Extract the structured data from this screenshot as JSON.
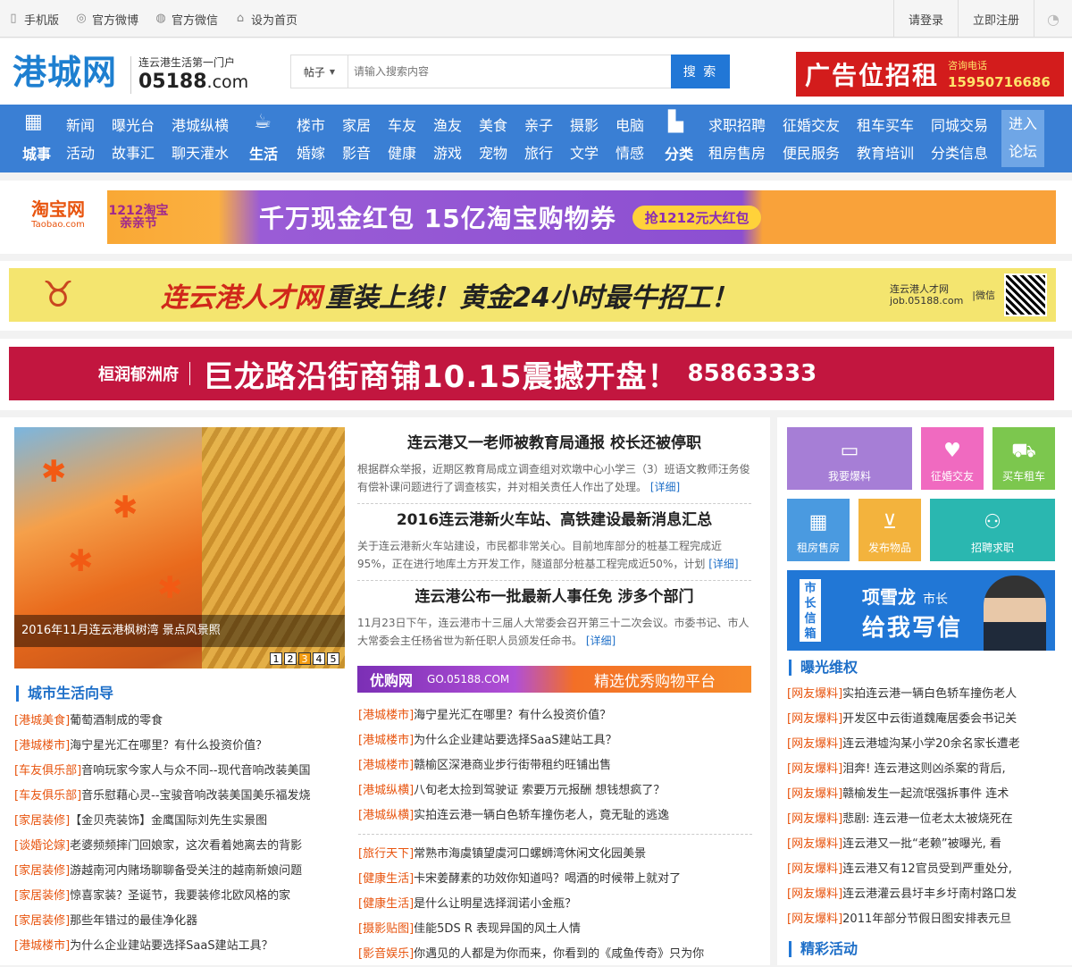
{
  "topbar": {
    "left": [
      {
        "icon": "mobile-icon",
        "label": "手机版"
      },
      {
        "icon": "weibo-icon",
        "label": "官方微博"
      },
      {
        "icon": "wechat-icon",
        "label": "官方微信"
      },
      {
        "icon": "home-icon",
        "label": "设为首页"
      }
    ],
    "login": "请登录",
    "register": "立即注册"
  },
  "header": {
    "logo": "港城网",
    "slogan": "连云港生活第一门户",
    "domain_num": "05188",
    "domain_tld": ".com",
    "search": {
      "type": "帖子",
      "placeholder": "请输入搜索内容",
      "button": "搜 索"
    },
    "ad": {
      "title": "广告位招租",
      "phone_label": "咨询电话",
      "phone": "15950716686"
    }
  },
  "nav": {
    "groups": [
      {
        "icon": "building-icon",
        "category": "城事",
        "row1": [
          "新闻",
          "曝光台",
          "港城纵横"
        ],
        "row2": [
          "活动",
          "故事汇",
          "聊天灌水"
        ]
      },
      {
        "icon": "cup-icon",
        "category": "生活",
        "row1": [
          "楼市",
          "家居",
          "车友",
          "渔友",
          "美食",
          "亲子",
          "摄影",
          "电脑"
        ],
        "row2": [
          "婚嫁",
          "影音",
          "健康",
          "游戏",
          "宠物",
          "旅行",
          "文学",
          "情感"
        ]
      },
      {
        "icon": "factory-icon",
        "category": "分类",
        "row1": [
          "求职招聘",
          "征婚交友",
          "租车买车",
          "同城交易"
        ],
        "row2": [
          "租房售房",
          "便民服务",
          "教育培训",
          "分类信息"
        ]
      }
    ],
    "enter": [
      "进入",
      "论坛"
    ]
  },
  "banners": {
    "taobao": {
      "brand": "淘宝网",
      "brand_sub": "Taobao.com",
      "event": "1212淘宝亲亲节",
      "main": "千万现金红包 15亿淘宝购物券",
      "pill": "抢1212元大红包"
    },
    "talent": {
      "t1": "连云港人才网",
      "t2": "重装上线！黄金24小时最牛招工！",
      "site": "连云港人才网",
      "url": "job.05188.com",
      "wx": "|微信"
    },
    "shop": {
      "logo": "桓润郁洲府",
      "main": "巨龙路沿街商铺10.15震撼开盘！",
      "phone": "85863333"
    }
  },
  "slider": {
    "caption": "2016年11月连云港枫树湾 景点风景照",
    "pages": [
      "1",
      "2",
      "3",
      "4",
      "5"
    ],
    "active": 3
  },
  "headlines": [
    {
      "title": "连云港又一老师被教育局通报 校长还被停职",
      "summary": "根据群众举报，近期区教育局成立调查组对欢墩中心小学三（3）班语文教师汪务俊有偿补课问题进行了调查核实，并对相关责任人作出了处理。",
      "more": "[详细]"
    },
    {
      "title": "2016连云港新火车站、高铁建设最新消息汇总",
      "summary": "关于连云港新火车站建设，市民都非常关心。目前地库部分的桩基工程完成近95%，正在进行地库土方开发工作，隧道部分桩基工程完成近50%，计划",
      "more": "[详细]"
    },
    {
      "title": "连云港公布一批最新人事任免 涉多个部门",
      "summary": "11月23日下午，连云港市十三届人大常委会召开第三十二次会议。市委书记、市人大常委会主任杨省世为新任职人员颁发任命书。",
      "more": "[详细]"
    }
  ],
  "shopbar": {
    "name": "优购网",
    "url": "GO.05188.COM",
    "slogan": "精选优秀购物平台"
  },
  "mid_list_a": [
    {
      "tag": "[港城楼市]",
      "text": "海宁星光汇在哪里？有什么投资价值？"
    },
    {
      "tag": "[港城楼市]",
      "text": "为什么企业建站要选择SaaS建站工具？"
    },
    {
      "tag": "[港城楼市]",
      "text": "赣榆区深港商业步行街带租约旺铺出售"
    },
    {
      "tag": "[港城纵横]",
      "text": "八旬老太捡到驾驶证 索要万元报酬 想钱想疯了？"
    },
    {
      "tag": "[港城纵横]",
      "text": "实拍连云港一辆白色轿车撞伤老人，竟无耻的逃逸"
    }
  ],
  "mid_list_b": [
    {
      "tag": "[旅行天下]",
      "text": "常熟市海虞镇望虞河口螺蛳湾休闲文化园美景"
    },
    {
      "tag": "[健康生活]",
      "text": "卡宋姜酵素的功效你知道吗？喝酒的时候带上就对了"
    },
    {
      "tag": "[健康生活]",
      "text": "是什么让明星选择润诺小金瓶？"
    },
    {
      "tag": "[摄影贴图]",
      "text": "佳能5DS R 表现异国的风土人情"
    },
    {
      "tag": "[影音娱乐]",
      "text": "你遇见的人都是为你而来，你看到的《咸鱼传奇》只为你"
    }
  ],
  "city_guide": {
    "title": "城市生活向导",
    "items": [
      {
        "tag": "[港城美食]",
        "text": "葡萄酒制成的零食"
      },
      {
        "tag": "[港城楼市]",
        "text": "海宁星光汇在哪里？有什么投资价值？"
      },
      {
        "tag": "[车友俱乐部]",
        "text": "音响玩家今家人与众不同--现代音响改装美国"
      },
      {
        "tag": "[车友俱乐部]",
        "text": "音乐慰藉心灵--宝骏音响改装美国美乐福发烧"
      },
      {
        "tag": "[家居装修]",
        "text": "【金贝壳装饰】金鹰国际刘先生实景图"
      },
      {
        "tag": "[谈婚论嫁]",
        "text": "老婆频频摔门回娘家，这次看着她离去的背影"
      },
      {
        "tag": "[家居装修]",
        "text": "游越南河内赌场聊聊备受关注的越南新娘问题"
      },
      {
        "tag": "[家居装修]",
        "text": "惊喜家装？圣诞节，我要装修北欧风格的家"
      },
      {
        "tag": "[家居装修]",
        "text": "那些年错过的最佳净化器"
      },
      {
        "tag": "[港城楼市]",
        "text": "为什么企业建站要选择SaaS建站工具？"
      }
    ]
  },
  "tiles": [
    {
      "icon": "chat-icon",
      "label": "我要爆料",
      "color": "#a67ed6"
    },
    {
      "icon": "heart-icon",
      "label": "征婚交友",
      "color": "#f06ac0"
    },
    {
      "icon": "car-icon",
      "label": "买车租车",
      "color": "#7cc74e"
    },
    {
      "icon": "grid-building-icon",
      "label": "租房售房",
      "color": "#4a9ae0"
    },
    {
      "icon": "basket-icon",
      "label": "发布物品",
      "color": "#f3b33d"
    },
    {
      "icon": "people-icon",
      "label": "招聘求职",
      "color": "#2ab7b0"
    }
  ],
  "mayor": {
    "vertical": "市长信箱",
    "name": "项雪龙",
    "title": "市长",
    "write": "给我写信"
  },
  "exposure": {
    "title": "曝光维权",
    "items": [
      {
        "tag": "[网友爆料]",
        "text": "实拍连云港一辆白色轿车撞伤老人"
      },
      {
        "tag": "[网友爆料]",
        "text": "开发区中云街道魏庵居委会书记关"
      },
      {
        "tag": "[网友爆料]",
        "text": "连云港墟沟某小学20余名家长遭老"
      },
      {
        "tag": "[网友爆料]",
        "text": "泪奔! 连云港这则凶杀案的背后,"
      },
      {
        "tag": "[网友爆料]",
        "text": "赣榆发生一起流氓强拆事件 连术"
      },
      {
        "tag": "[网友爆料]",
        "text": "悲剧: 连云港一位老太太被烧死在"
      },
      {
        "tag": "[网友爆料]",
        "text": "连云港又一批“老赖”被曝光, 看"
      },
      {
        "tag": "[网友爆料]",
        "text": "连云港又有12官员受到严重处分,"
      },
      {
        "tag": "[网友爆料]",
        "text": "连云港灌云县圩丰乡圩南村路口发"
      },
      {
        "tag": "[网友爆料]",
        "text": "2011年部分节假日图安排表元旦"
      }
    ]
  },
  "activity": {
    "title": "精彩活动"
  }
}
